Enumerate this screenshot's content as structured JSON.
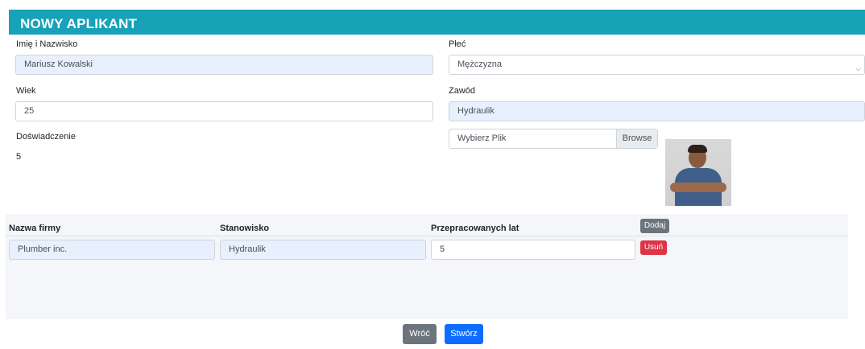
{
  "header": {
    "title": "NOWY APLIKANT"
  },
  "form": {
    "name_label": "Imię i Nazwisko",
    "name_value": "Mariusz Kowalski",
    "gender_label": "Płeć",
    "gender_value": "Mężczyzna",
    "age_label": "Wiek",
    "age_value": "25",
    "profession_label": "Zawód",
    "profession_value": "Hydraulik",
    "experience_label": "Doświadczenie",
    "experience_value": "5",
    "file_placeholder": "Wybierz Plik",
    "browse_label": "Browse"
  },
  "jobs": {
    "columns": [
      "Nazwa firmy",
      "Stanowisko",
      "Przepracowanych lat"
    ],
    "add_label": "Dodaj",
    "rows": [
      {
        "company": "Plumber inc.",
        "position": "Hydraulik",
        "years": "5",
        "remove_label": "Usuń"
      }
    ]
  },
  "actions": {
    "back_label": "Wróć",
    "create_label": "Stwórz"
  },
  "icons": {
    "select_arrow": "chevron-down-icon",
    "photo": "applicant-photo"
  },
  "colors": {
    "header": "#17a2b8",
    "filled_input": "#e8f0fe",
    "danger": "#dc3545",
    "primary": "#0d6efd",
    "secondary": "#6c757d"
  }
}
